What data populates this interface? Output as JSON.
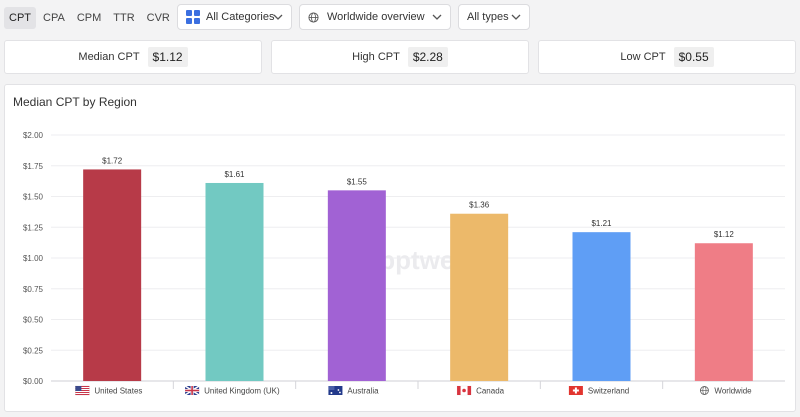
{
  "metric_tabs": [
    "CPT",
    "CPA",
    "CPM",
    "TTR",
    "CVR"
  ],
  "active_tab": "CPT",
  "filters": {
    "category": "All Categories",
    "region": "Worldwide overview",
    "type": "All types"
  },
  "summary": {
    "median": {
      "label": "Median CPT",
      "value": "$1.12"
    },
    "high": {
      "label": "High CPT",
      "value": "$2.28"
    },
    "low": {
      "label": "Low CPT",
      "value": "$0.55"
    }
  },
  "chart_data": {
    "type": "bar",
    "title": "Median CPT by Region",
    "categories": [
      "United States",
      "United Kingdom (UK)",
      "Australia",
      "Canada",
      "Switzerland",
      "Worldwide"
    ],
    "values": [
      1.72,
      1.61,
      1.55,
      1.36,
      1.21,
      1.12
    ],
    "data_labels": [
      "$1.72",
      "$1.61",
      "$1.55",
      "$1.36",
      "$1.21",
      "$1.12"
    ],
    "colors": [
      "#b73a48",
      "#72c9c2",
      "#a162d4",
      "#ecb96a",
      "#5f9ef5",
      "#ef7d86"
    ],
    "flags": [
      "us-flag-icon",
      "uk-flag-icon",
      "australia-flag-icon",
      "canada-flag-icon",
      "switzerland-flag-icon",
      "globe-icon"
    ],
    "ylim": [
      0,
      2
    ],
    "yticks": [
      "$0.00",
      "$0.25",
      "$0.50",
      "$0.75",
      "$1.00",
      "$1.25",
      "$1.50",
      "$1.75",
      "$2.00"
    ],
    "grid": true,
    "watermark": "apptweak"
  }
}
